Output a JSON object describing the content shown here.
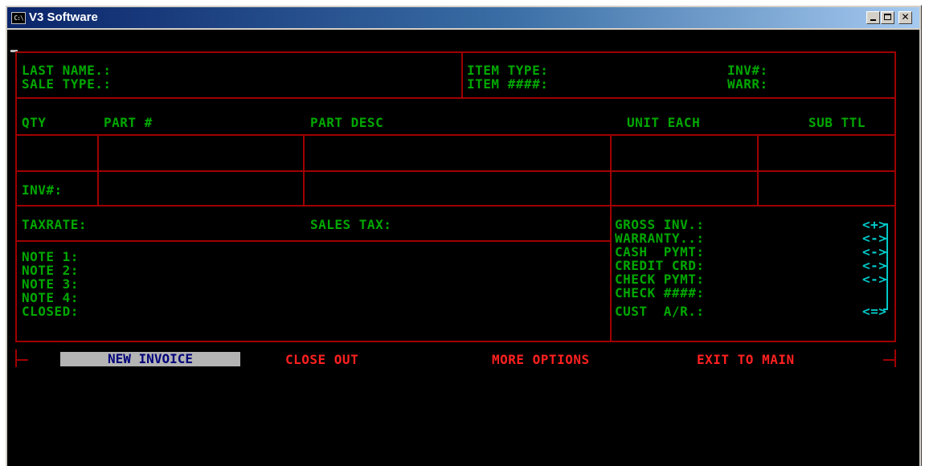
{
  "window": {
    "title": "V3 Software",
    "icon_text": "C:\\"
  },
  "header": {
    "last_name": "LAST NAME.:",
    "sale_type": "SALE TYPE.:",
    "item_type": "ITEM TYPE:",
    "item_num": "ITEM ####:",
    "inv_num": "INV#:",
    "warr": "WARR:"
  },
  "columns": {
    "qty": "QTY",
    "part_num": "PART #",
    "part_desc": "PART DESC",
    "unit_each": "UNIT EACH",
    "sub_ttl": "SUB TTL"
  },
  "row_label": "INV#:",
  "tax": {
    "taxrate": "TAXRATE:",
    "sales_tax": "SALES TAX:"
  },
  "notes": [
    "NOTE 1:",
    "NOTE 2:",
    "NOTE 3:",
    "NOTE 4:",
    "CLOSED:"
  ],
  "totals": [
    {
      "label": "GROSS INV.:",
      "op": "<+>"
    },
    {
      "label": "WARRANTY..:",
      "op": "<->"
    },
    {
      "label": "CASH  PYMT:",
      "op": "<->"
    },
    {
      "label": "CREDIT CRD:",
      "op": "<->"
    },
    {
      "label": "CHECK PYMT:",
      "op": "<->"
    },
    {
      "label": "CHECK ####:",
      "op": ""
    },
    {
      "label": "CUST  A/R.:",
      "op": "<=>"
    }
  ],
  "menu": {
    "new_invoice": "NEW INVOICE",
    "close_out": "CLOSE OUT",
    "more_options": "MORE OPTIONS",
    "exit_to_main": "EXIT TO MAIN"
  },
  "colors": {
    "frame": "#a00000",
    "label_green": "#00a800",
    "menu_red": "#ff2020",
    "highlight_bg": "#b4b4b4",
    "highlight_fg": "#00007a",
    "bracket": "#00c8c8"
  }
}
